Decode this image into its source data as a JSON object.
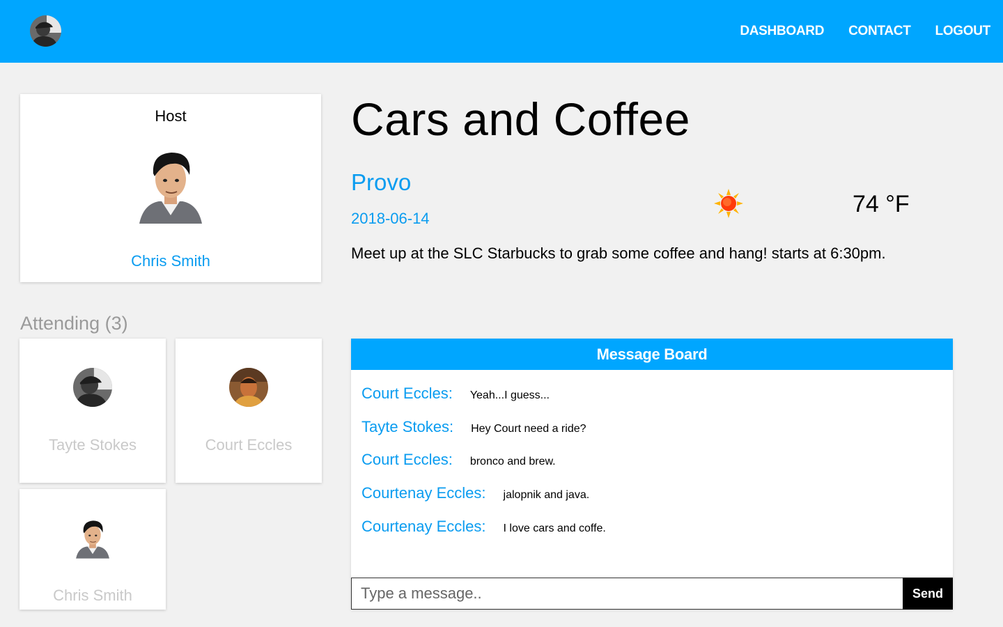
{
  "nav": {
    "links": [
      "DASHBOARD",
      "CONTACT",
      "LOGOUT"
    ]
  },
  "host": {
    "title": "Host",
    "name": "Chris Smith"
  },
  "attending": {
    "title": "Attending (3)",
    "people": [
      {
        "name": "Tayte Stokes"
      },
      {
        "name": "Court Eccles"
      },
      {
        "name": "Chris Smith"
      }
    ]
  },
  "event": {
    "title": "Cars and Coffee",
    "city": "Provo",
    "date": "2018-06-14",
    "weather_icon": "sun-icon",
    "temperature": "74 °F",
    "description": "Meet up at the SLC Starbucks to grab some coffee and hang! starts at 6:30pm."
  },
  "message_board": {
    "title": "Message Board",
    "messages": [
      {
        "author": "Court Eccles:",
        "text": "Yeah...I guess..."
      },
      {
        "author": "Tayte Stokes:",
        "text": "Hey Court need a ride?"
      },
      {
        "author": "Court Eccles:",
        "text": "bronco and brew."
      },
      {
        "author": "Courtenay Eccles:",
        "text": "jalopnik and java."
      },
      {
        "author": "Courtenay Eccles:",
        "text": "I love cars and coffe."
      }
    ],
    "input_placeholder": "Type a message..",
    "send_label": "Send"
  },
  "colors": {
    "primary": "#00a6ff",
    "link": "#0a9cf0",
    "muted": "#9a9a9a"
  }
}
